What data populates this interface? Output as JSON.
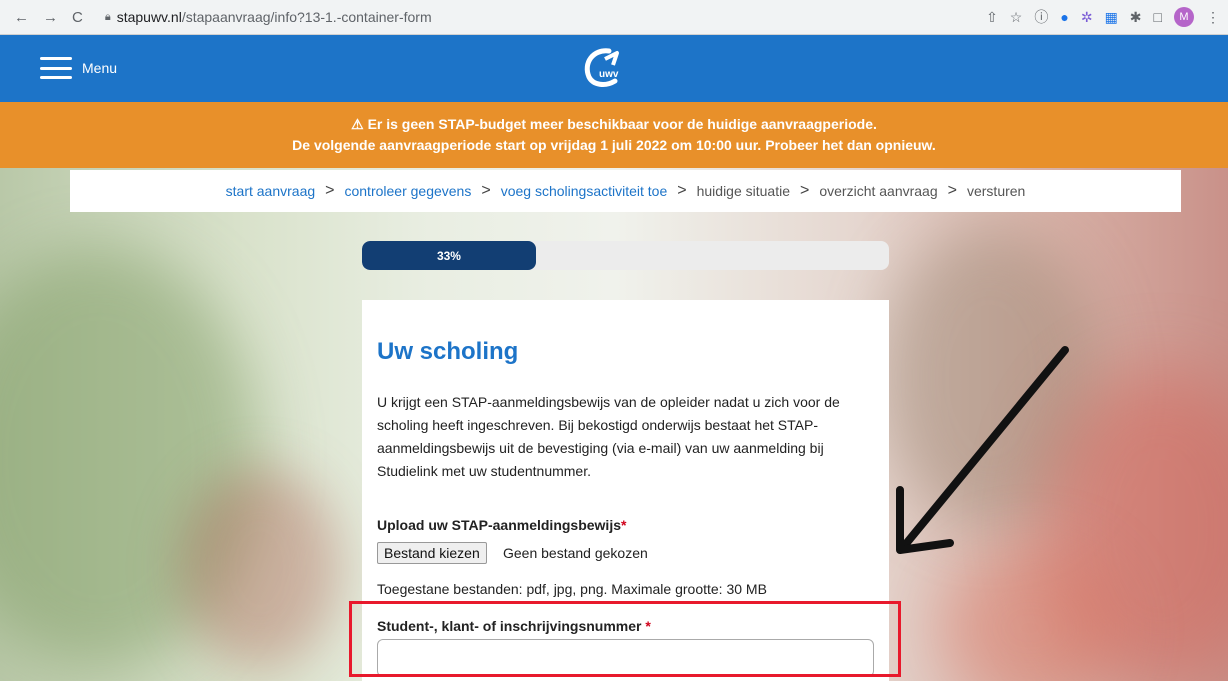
{
  "browser": {
    "url_host": "stapuwv.nl",
    "url_path": "/stapaanvraag/info?13-1.-container-form",
    "profile_initial": "M"
  },
  "header": {
    "menu_label": "Menu",
    "logo_text": "uwv",
    "color": "#1d74c8"
  },
  "alert": {
    "line1": "Er is geen STAP-budget meer beschikbaar voor de huidige aanvraagperiode.",
    "line2": "De volgende aanvraagperiode start op vrijdag 1 juli 2022 om 10:00 uur. Probeer het dan opnieuw.",
    "color": "#e8902a"
  },
  "steps": [
    {
      "label": "start aanvraag",
      "state": "done"
    },
    {
      "label": "controleer gegevens",
      "state": "done"
    },
    {
      "label": "voeg scholingsactiviteit toe",
      "state": "current"
    },
    {
      "label": "huidige situatie",
      "state": "future"
    },
    {
      "label": "overzicht aanvraag",
      "state": "future"
    },
    {
      "label": "versturen",
      "state": "future"
    }
  ],
  "progress": {
    "label": "33%",
    "value": 0.33
  },
  "form": {
    "title": "Uw scholing",
    "intro": "U krijgt een STAP-aanmeldingsbewijs van de opleider nadat u zich voor de scholing heeft ingeschreven. Bij bekostigd onderwijs bestaat het STAP-aanmeldingsbewijs uit de bevestiging (via e-mail) van uw aanmelding bij Studielink met uw studentnummer.",
    "upload_label": "Upload uw STAP-aanmeldingsbewijs",
    "required_mark": "*",
    "file_button": "Bestand kiezen",
    "file_status": "Geen bestand gekozen",
    "allowed": "Toegestane bestanden: pdf, jpg, png. Maximale grootte: 30 MB",
    "student_label": "Student-, klant- of inschrijvingsnummer",
    "student_value": ""
  }
}
